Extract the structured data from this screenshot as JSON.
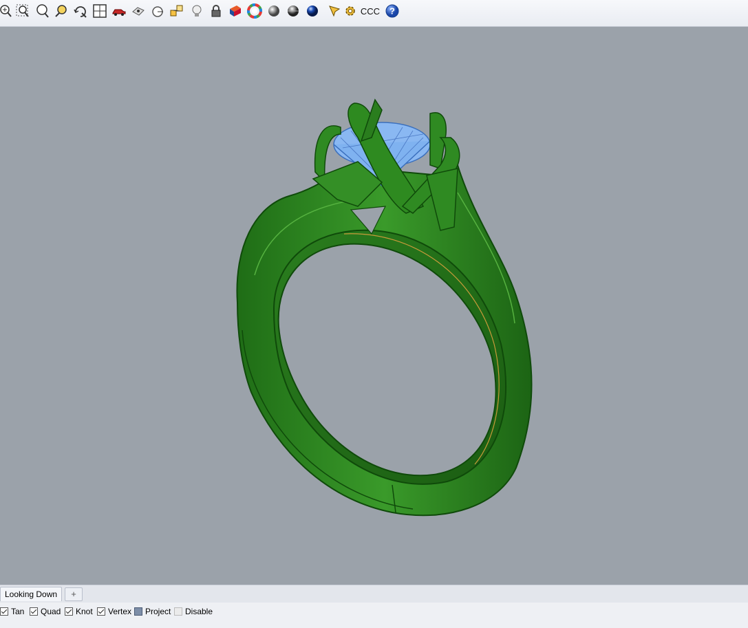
{
  "toolbar": {
    "icons": [
      "zoom-extents-icon",
      "zoom-window-icon",
      "zoom-selected-icon",
      "zoom-dynamic-icon",
      "rotate-view-icon",
      "four-viewports-icon",
      "car-render-icon",
      "named-view-icon",
      "target-icon",
      "object-snap-icon",
      "light-bulb-icon",
      "lock-icon",
      "material-icon",
      "color-wheel-icon",
      "gray-sphere-icon",
      "shaded-sphere-icon",
      "blue-sphere-icon",
      "pointer-arrow-icon",
      "gear-icon",
      "ccc-label",
      "help-icon"
    ],
    "ccc_label": "CCC"
  },
  "viewport": {
    "background_color": "#9ba2aa",
    "ring_color": "#2f8a22",
    "gem_color": "#7fb2f0"
  },
  "tabs": {
    "active": "Looking Down",
    "add_symbol": "+"
  },
  "osnaps": [
    {
      "label": "Tan",
      "state": "checked"
    },
    {
      "label": "Quad",
      "state": "checked"
    },
    {
      "label": "Knot",
      "state": "checked"
    },
    {
      "label": "Vertex",
      "state": "checked"
    },
    {
      "label": "Project",
      "state": "filled"
    },
    {
      "label": "Disable",
      "state": "empty"
    }
  ]
}
